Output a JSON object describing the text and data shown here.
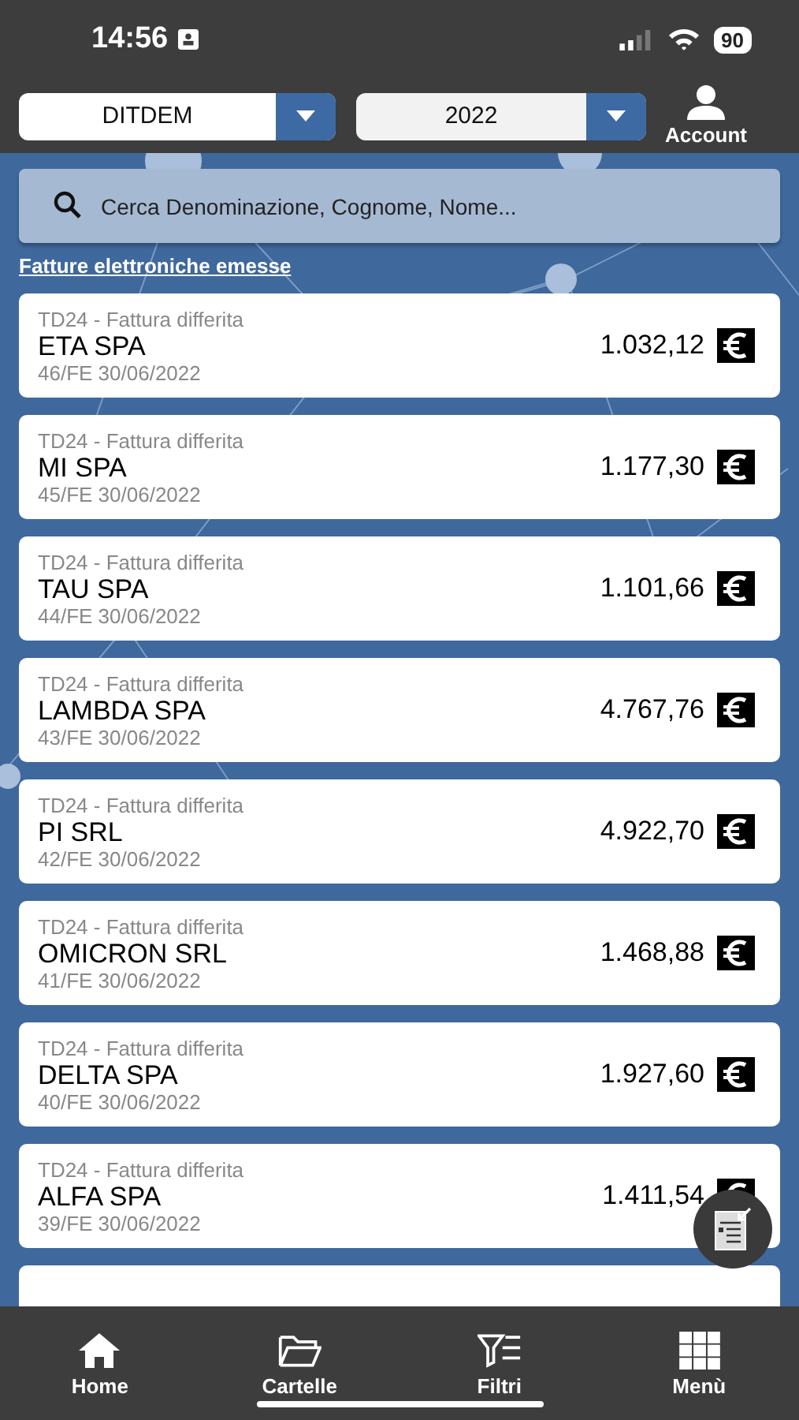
{
  "status_bar": {
    "time": "14:56",
    "battery": "90"
  },
  "header": {
    "company": {
      "value": "DITDEM"
    },
    "year": {
      "value": "2022"
    },
    "account": "Account"
  },
  "search": {
    "placeholder": "Cerca Denominazione, Cognome, Nome..."
  },
  "section_link": "Fatture elettroniche emesse",
  "invoices": [
    {
      "type": "TD24 - Fattura differita",
      "name": "ETA SPA",
      "number": "46/FE 30/06/2022",
      "amount": "1.032,12"
    },
    {
      "type": "TD24 - Fattura differita",
      "name": "MI SPA",
      "number": "45/FE 30/06/2022",
      "amount": "1.177,30"
    },
    {
      "type": "TD24 - Fattura differita",
      "name": "TAU SPA",
      "number": "44/FE 30/06/2022",
      "amount": "1.101,66"
    },
    {
      "type": "TD24 - Fattura differita",
      "name": "LAMBDA SPA",
      "number": "43/FE 30/06/2022",
      "amount": "4.767,76"
    },
    {
      "type": "TD24 - Fattura differita",
      "name": "PI SRL",
      "number": "42/FE 30/06/2022",
      "amount": "4.922,70"
    },
    {
      "type": "TD24 - Fattura differita",
      "name": "OMICRON SRL",
      "number": "41/FE 30/06/2022",
      "amount": "1.468,88"
    },
    {
      "type": "TD24 - Fattura differita",
      "name": "DELTA SPA",
      "number": "40/FE 30/06/2022",
      "amount": "1.927,60"
    },
    {
      "type": "TD24 - Fattura differita",
      "name": "ALFA SPA",
      "number": "39/FE 30/06/2022",
      "amount": "1.411,54"
    }
  ],
  "bottom_nav": [
    {
      "kind": "home",
      "label": "Home"
    },
    {
      "kind": "folder",
      "label": "Cartelle"
    },
    {
      "kind": "filter",
      "label": "Filtri"
    },
    {
      "kind": "grid",
      "label": "Menù"
    }
  ]
}
